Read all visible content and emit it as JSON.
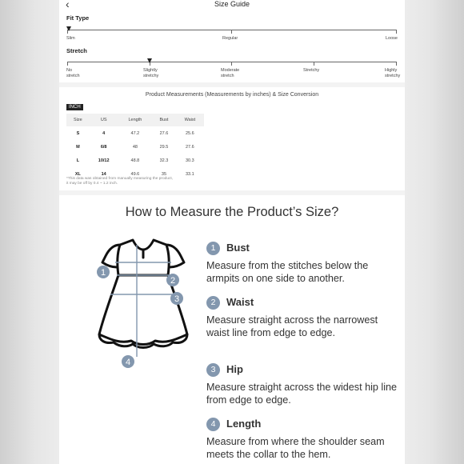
{
  "header": {
    "back_icon": "chevron-left-icon",
    "title": "Size Guide"
  },
  "fit_type": {
    "label": "Fit Type",
    "options": [
      "Slim",
      "Regular",
      "Loose"
    ],
    "selected": "Slim"
  },
  "stretch": {
    "label": "Stretch",
    "options": [
      {
        "line1": "No",
        "line2": "stretch"
      },
      {
        "line1": "Slightly",
        "line2": "stretchy"
      },
      {
        "line1": "Moderate",
        "line2": "stretch"
      },
      {
        "line1": "Stretchy",
        "line2": ""
      },
      {
        "line1": "Highly",
        "line2": "stretchy"
      }
    ],
    "selected": "Slightly stretchy"
  },
  "measurements": {
    "title": "Product Measurements (Measurements by inches) & Size Conversion",
    "unit_badge": "INCH",
    "columns": [
      "Size",
      "US",
      "Length",
      "Bust",
      "Waist"
    ],
    "rows": [
      [
        "S",
        "4",
        "47.2",
        "27.6",
        "25.6"
      ],
      [
        "M",
        "6/8",
        "48",
        "29.5",
        "27.6"
      ],
      [
        "L",
        "10/12",
        "48.8",
        "32.3",
        "30.3"
      ],
      [
        "XL",
        "14",
        "49.6",
        "35",
        "33.1"
      ]
    ],
    "note_line1": "*This data was obtained from manually measuring the product,",
    "note_line2": " it may be off by 0.4 ~ 1.2 inch."
  },
  "how_to": {
    "title": "How to Measure the Product’s Size?",
    "steps": [
      {
        "num": "1",
        "name": "Bust",
        "desc": "Measure from the stitches below the armpits on one side to another."
      },
      {
        "num": "2",
        "name": "Waist",
        "desc": "Measure straight across the narrowest waist line from edge to edge."
      },
      {
        "num": "3",
        "name": "Hip",
        "desc": "Measure straight across the widest hip line from edge to edge."
      },
      {
        "num": "4",
        "name": "Length",
        "desc": "Measure from where the shoulder seam meets the collar to the hem."
      }
    ],
    "diagram_labels": [
      "1",
      "2",
      "3",
      "4"
    ],
    "accent_color": "#8397ae"
  }
}
